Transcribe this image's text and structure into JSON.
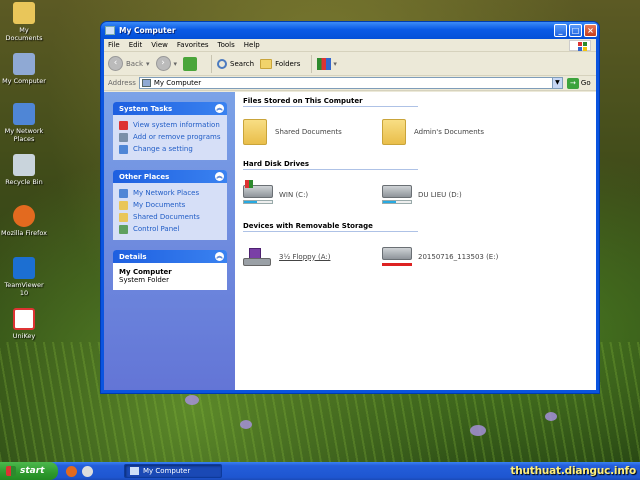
{
  "desktop": {
    "icons": [
      {
        "label": "My Documents",
        "color": "#e9c65a"
      },
      {
        "label": "My Computer",
        "color": "#8fa9d4"
      },
      {
        "label": "My Network Places",
        "color": "#4f86d6"
      },
      {
        "label": "Recycle Bin",
        "color": "#c9d4dc"
      },
      {
        "label": "Mozilla Firefox",
        "color": "#e36a1f"
      },
      {
        "label": "TeamViewer 10",
        "color": "#1c6fd2"
      },
      {
        "label": "UniKey",
        "color": "#d33"
      }
    ]
  },
  "window": {
    "title": "My Computer",
    "menu": [
      "File",
      "Edit",
      "View",
      "Favorites",
      "Tools",
      "Help"
    ],
    "toolbar": {
      "back": "Back",
      "search": "Search",
      "folders": "Folders"
    },
    "address": {
      "label": "Address",
      "value": "My Computer",
      "go": "Go"
    }
  },
  "sidebar": {
    "system_tasks": {
      "title": "System Tasks",
      "items": [
        "View system information",
        "Add or remove programs",
        "Change a setting"
      ]
    },
    "other_places": {
      "title": "Other Places",
      "items": [
        "My Network Places",
        "My Documents",
        "Shared Documents",
        "Control Panel"
      ]
    },
    "details": {
      "title": "Details",
      "name": "My Computer",
      "type": "System Folder"
    }
  },
  "main": {
    "groups": [
      {
        "title": "Files Stored on This Computer",
        "items": [
          "Shared Documents",
          "Admin's Documents"
        ]
      },
      {
        "title": "Hard Disk Drives",
        "items": [
          {
            "label": "WIN (C:)",
            "used": 0.45
          },
          {
            "label": "DU LIEU (D:)",
            "used": 0.45
          }
        ]
      },
      {
        "title": "Devices with Removable Storage",
        "items": [
          "3½ Floppy (A:)",
          "20150716_113503 (E:)"
        ]
      }
    ]
  },
  "taskbar": {
    "start": "start",
    "task": "My Computer",
    "watermark": "thuthuat.dianguc.info"
  }
}
